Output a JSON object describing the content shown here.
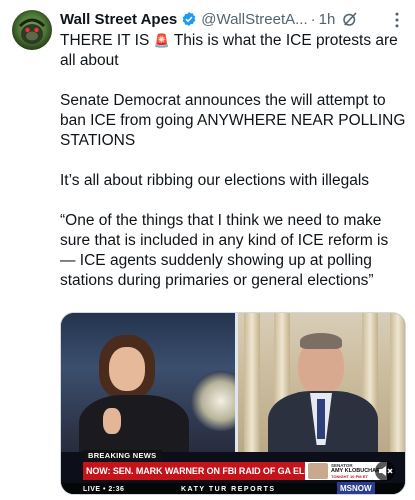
{
  "tweet": {
    "author_name": "Wall Street Apes",
    "handle": "@WallStreetA...",
    "separator": "·",
    "time": "1h",
    "paragraphs": [
      "THERE IT IS",
      "This is what the ICE protests are all about",
      "Senate Democrat announces the will attempt to ban ICE from going ANYWHERE NEAR POLLING STATIONS",
      "It’s all about ribbing our elections with illegals",
      "“One of the things that I think we need to make sure that is included in any kind of ICE reform is — ICE agents suddenly showing up at polling stations during primaries or general elections”"
    ],
    "siren_emoji": "🚨"
  },
  "video": {
    "breaking_label": "BREAKING NEWS",
    "headline": "NOW: SEN. MARK WARNER ON FBI RAID OF GA ELECTION OFFICE",
    "promo_line1": "SENATOR",
    "promo_line2": "AMY KLOBUCHAR",
    "promo_line3": "TONIGHT 10 PM ET",
    "live_text": "LIVE • 2:36",
    "show_text": "KATY TUR REPORTS",
    "network": "MSNOW"
  },
  "icons": {
    "verified": "verified-badge-icon",
    "grok": "grok-icon",
    "more": "more-options-icon",
    "mute": "mute-icon"
  },
  "colors": {
    "verified_blue": "#1d9bf0",
    "text": "#0f1419",
    "secondary": "#536471",
    "chyron_red": "#c4141b"
  }
}
